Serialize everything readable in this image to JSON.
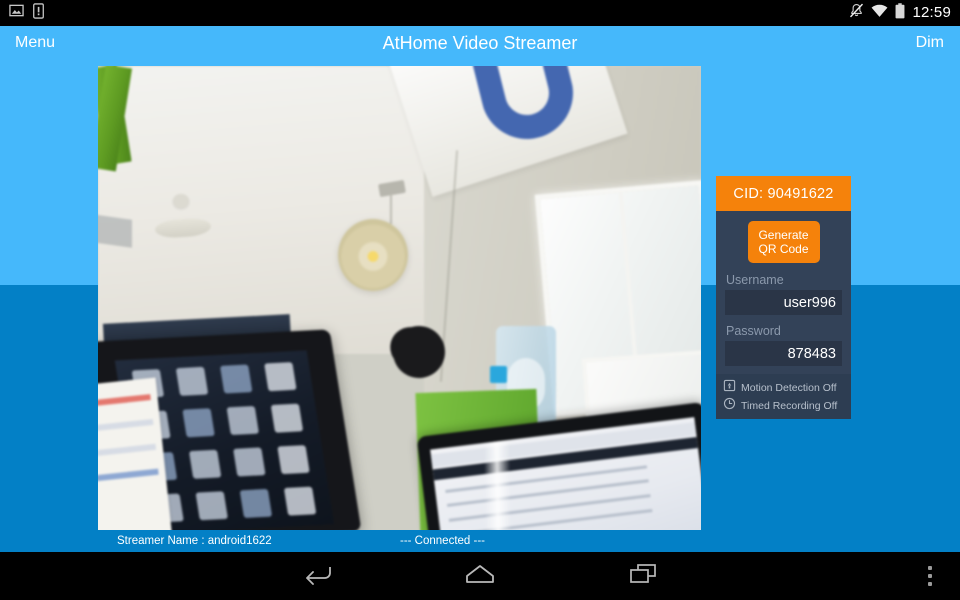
{
  "status_bar": {
    "time": "12:59",
    "left_icons": [
      {
        "name": "screenshot-notification-icon",
        "label": "Screenshot captured"
      },
      {
        "name": "sim-card-warning-icon",
        "label": "SIM card warning"
      }
    ],
    "right_icons": [
      {
        "name": "ringer-silent-icon",
        "label": "Silent mode"
      },
      {
        "name": "wifi-icon",
        "label": "Wi-Fi connected"
      },
      {
        "name": "battery-icon",
        "label": "Battery"
      }
    ]
  },
  "title_bar": {
    "menu_label": "Menu",
    "title": "AtHome Video Streamer",
    "dim_label": "Dim"
  },
  "info_panel": {
    "cid_label": "CID: 90491622",
    "qr_button_line1": "Generate",
    "qr_button_line2": "QR Code",
    "username_label": "Username",
    "username_value": "user996",
    "password_label": "Password",
    "password_value": "878483"
  },
  "status_tile": {
    "motion_detection": "Motion Detection Off",
    "timed_recording": "Timed Recording Off",
    "motion_icon": "motion-detection-icon",
    "timer_icon": "clock-icon"
  },
  "stream_bar": {
    "streamer_name_label": "Streamer Name   : android1622",
    "connection_status": "--- Connected ---"
  },
  "nav_bar": {
    "back_label": "Back",
    "home_label": "Home",
    "recent_label": "Recent apps",
    "overflow_label": "More options"
  },
  "colors": {
    "title_bar": "#45b8fb",
    "background_top": "#45b8fb",
    "background_bottom": "#0380c6",
    "accent_orange": "#f5820b",
    "panel_dark": "#334258",
    "input_dark": "#2a3547",
    "status_tile": "#2d3d52"
  }
}
